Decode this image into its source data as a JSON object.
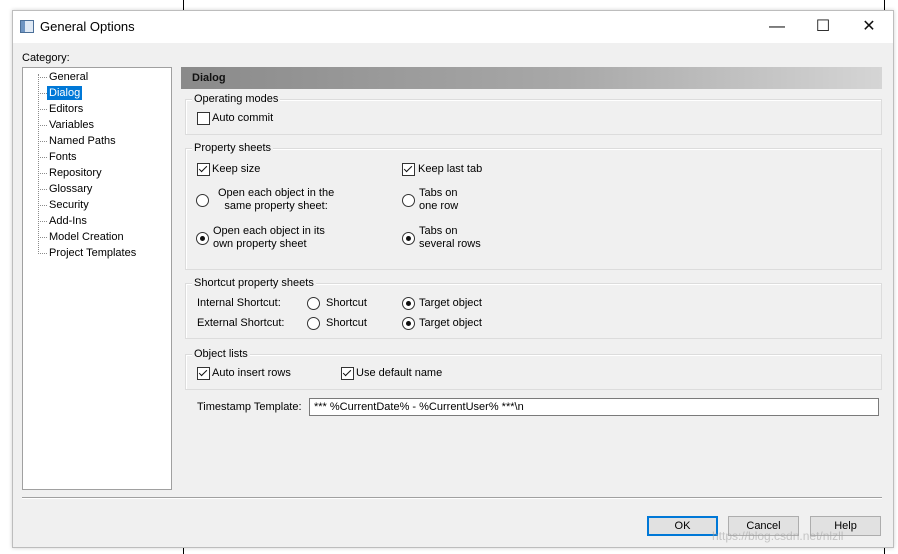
{
  "window": {
    "title": "General Options"
  },
  "titlebar_buttons": {
    "minimize": "—",
    "maximize": "☐",
    "close": "✕"
  },
  "category": {
    "label": "Category:",
    "items": [
      "General",
      "Dialog",
      "Editors",
      "Variables",
      "Named Paths",
      "Fonts",
      "Repository",
      "Glossary",
      "Security",
      "Add-Ins",
      "Model Creation",
      "Project Templates"
    ],
    "selected": "Dialog"
  },
  "panel": {
    "header": "Dialog"
  },
  "operating_modes": {
    "title": "Operating modes",
    "auto_commit": {
      "label": "Auto commit",
      "checked": false
    }
  },
  "property_sheets": {
    "title": "Property sheets",
    "keep_size": {
      "label": "Keep size",
      "checked": true
    },
    "keep_last_tab": {
      "label": "Keep last tab",
      "checked": true
    },
    "open_same": {
      "line1": "Open each object in the",
      "line2": "same property sheet:",
      "selected": false
    },
    "open_own": {
      "line1": "Open each object in its",
      "line2": "own property sheet",
      "selected": true
    },
    "tabs_one_row": {
      "line1": "Tabs on",
      "line2": "one row",
      "selected": false
    },
    "tabs_several_rows": {
      "line1": "Tabs on",
      "line2": "several rows",
      "selected": true
    }
  },
  "shortcut_sheets": {
    "title": "Shortcut property sheets",
    "internal": {
      "label": "Internal Shortcut:",
      "opt1": "Shortcut",
      "opt2": "Target object",
      "selected": "Target object"
    },
    "external": {
      "label": "External Shortcut:",
      "opt1": "Shortcut",
      "opt2": "Target object",
      "selected": "Target object"
    }
  },
  "object_lists": {
    "title": "Object lists",
    "auto_insert_rows": {
      "label": "Auto insert rows",
      "checked": true
    },
    "use_default_name": {
      "label": "Use default name",
      "checked": true
    }
  },
  "timestamp": {
    "label": "Timestamp Template:",
    "value": "*** %CurrentDate% - %CurrentUser% ***\\n"
  },
  "buttons": {
    "ok": "OK",
    "cancel": "Cancel",
    "help": "Help"
  },
  "watermark": "https://blog.csdn.net/nlzll",
  "colors": {
    "selection": "#0078d7",
    "dialog_bg": "#f0f0f0",
    "header_gradient_start": "#8a8a8a"
  }
}
